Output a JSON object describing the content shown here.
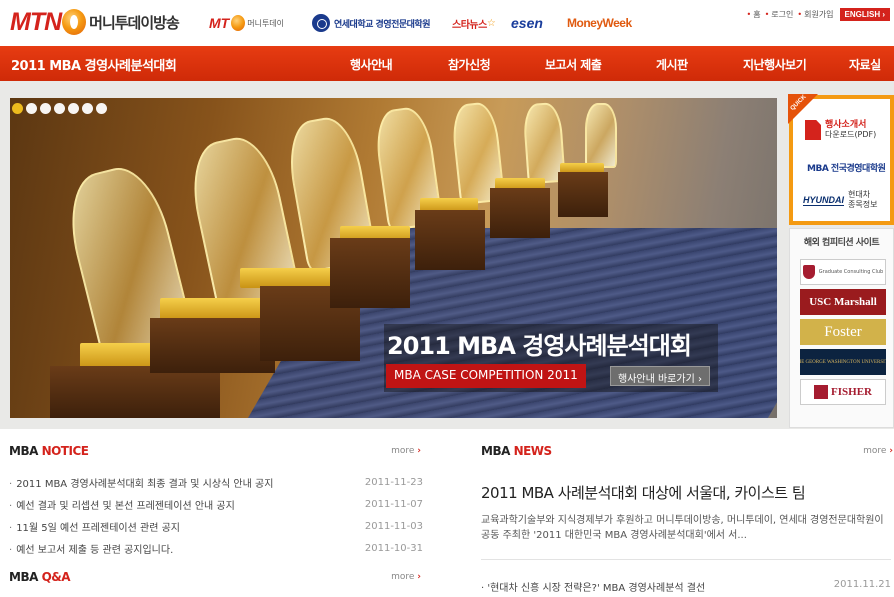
{
  "brand": {
    "mtn_word": "MTN",
    "mtn_korean": "머니투데이방송"
  },
  "partners": {
    "mt_word": "MT",
    "mt_korean": "머니투데이",
    "yonsei": "연세대학교 경영전문대학원",
    "starnews": "스타뉴스",
    "esen": "esen",
    "moneyweek": "MoneyWeek"
  },
  "utility": {
    "home": "홈",
    "login": "로그인",
    "join": "회원가입",
    "english": "ENGLISH"
  },
  "nav": {
    "site_title": "2011 MBA 경영사례분석대회",
    "items": [
      {
        "label": "행사안내"
      },
      {
        "label": "참가신청"
      },
      {
        "label": "보고서 제출"
      },
      {
        "label": "게시판"
      },
      {
        "label": "지난행사보기"
      },
      {
        "label": "자료실"
      }
    ]
  },
  "hero": {
    "slide_count": 7,
    "active_slide": 1,
    "title": "2011 MBA 경영사례분석대회",
    "subtitle": "MBA CASE COMPETITION 2011",
    "button": "행사안내 바로가기"
  },
  "quick": {
    "tag": "QUICK",
    "pdf_line1": "행사소개서",
    "pdf_line2": "다운로드(PDF)",
    "mba_school": "MBA 전국경영대학원",
    "hyundai_logo": "HYUNDAI",
    "hyundai_line1": "현대차",
    "hyundai_line2": "종목정보"
  },
  "intl": {
    "title": "해외 컴피티션 사이트",
    "schools": {
      "harvard": "Graduate Consulting Club",
      "marshall": "USC Marshall",
      "foster": "Foster",
      "gwu": "THE GEORGE WASHINGTON UNIVERSITY",
      "fisher": "FISHER"
    }
  },
  "notice": {
    "title_mba": "MBA",
    "title_accent": "NOTICE",
    "more": "more",
    "items": [
      {
        "title": "2011 MBA 경영사례분석대회 최종 결과 및 시상식 안내 공지",
        "date": "2011-11-23"
      },
      {
        "title": "예선 결과 및 리셉션 및 본선 프레젠테이션 안내 공지",
        "date": "2011-11-07"
      },
      {
        "title": "11월 5일 예선 프레젠테이션 관련 공지",
        "date": "2011-11-03"
      },
      {
        "title": "예선 보고서 제출 등 관련 공지입니다.",
        "date": "2011-10-31"
      }
    ]
  },
  "news": {
    "title_mba": "MBA",
    "title_accent": "NEWS",
    "more": "more",
    "headline": "2011 MBA 사례분석대회 대상에 서울대, 카이스트 팀",
    "summary": "교육과학기술부와 지식경제부가 후원하고 머니투데이방송, 머니투데이, 연세대 경영전문대학원이 공동 주최한 '2011 대한민국 MBA 경영사례분석대회'에서 서...",
    "item_title": "'현대차 신흥 시장 전략은?' MBA 경영사례분석 결선",
    "item_date": "2011.11.21"
  },
  "qna": {
    "title_mba": "MBA",
    "title_accent": "Q&A",
    "more": "more"
  },
  "colors": {
    "brand_red": "#d4231c",
    "nav_orange_red": "#e73c12",
    "quick_orange": "#f49a12",
    "caption_red": "#c01414"
  }
}
